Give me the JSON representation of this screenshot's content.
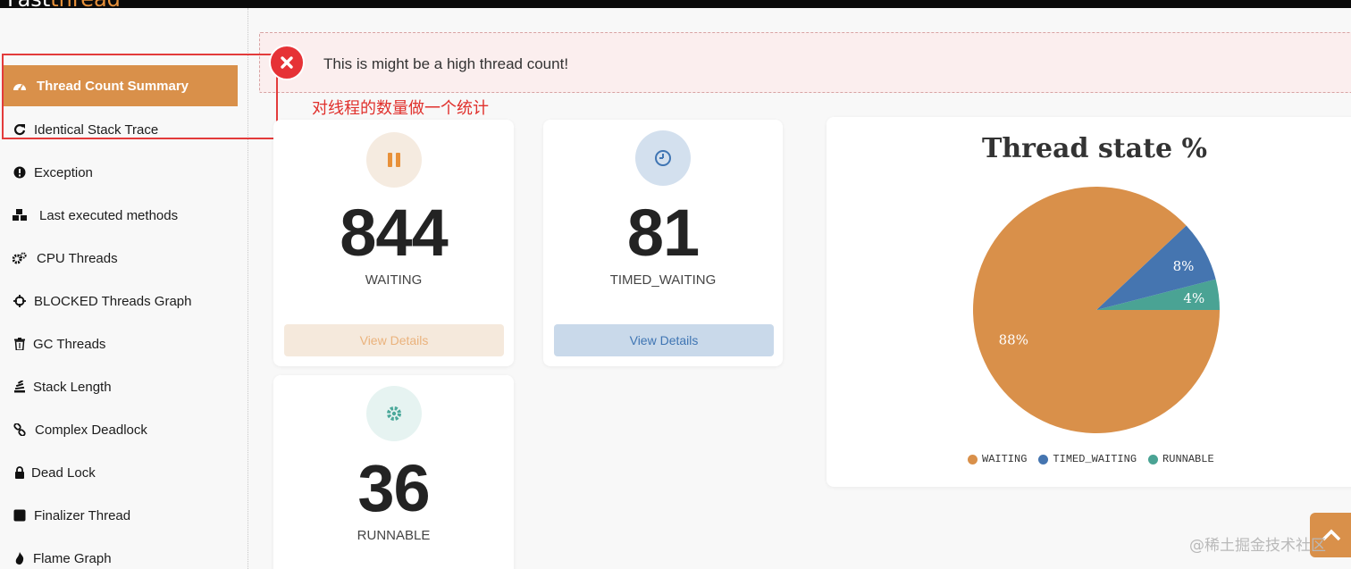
{
  "app": {
    "logo_part1": "Fast",
    "logo_part2": "thread"
  },
  "sidebar": {
    "items": [
      {
        "label": "Thread Count Summary",
        "icon": "dashboard-icon"
      },
      {
        "label": "Identical Stack Trace",
        "icon": "refresh-icon"
      },
      {
        "label": "Exception",
        "icon": "exclamation-circle-icon"
      },
      {
        "label": "Last executed methods",
        "icon": "cubes-icon"
      },
      {
        "label": "CPU Threads",
        "icon": "cogs-icon"
      },
      {
        "label": "BLOCKED Threads Graph",
        "icon": "crosshairs-icon"
      },
      {
        "label": "GC Threads",
        "icon": "trash-icon"
      },
      {
        "label": "Stack Length",
        "icon": "stack-icon"
      },
      {
        "label": "Complex Deadlock",
        "icon": "link-icon"
      },
      {
        "label": "Dead Lock",
        "icon": "lock-icon"
      },
      {
        "label": "Finalizer Thread",
        "icon": "square-icon"
      },
      {
        "label": "Flame Graph",
        "icon": "fire-icon"
      }
    ]
  },
  "alert": {
    "text": "This is might be a high thread count!",
    "icon": "close-circle-icon"
  },
  "annotation": {
    "text": "对线程的数量做一个统计"
  },
  "cards": {
    "waiting": {
      "count": "844",
      "label": "WAITING",
      "button": "View Details",
      "icon": "pause-icon",
      "color": "#e8913a"
    },
    "timed_waiting": {
      "count": "81",
      "label": "TIMED_WAITING",
      "button": "View Details",
      "icon": "clock-icon",
      "color": "#3f75b3"
    },
    "runnable": {
      "count": "36",
      "label": "RUNNABLE",
      "icon": "gear-icon",
      "color": "#4aa89a"
    }
  },
  "chart_data": {
    "type": "pie",
    "title": "Thread state %",
    "slices": [
      {
        "name": "WAITING",
        "value": 88,
        "label": "88%",
        "color": "#d9904a"
      },
      {
        "name": "TIMED_WAITING",
        "value": 8,
        "label": "8%",
        "color": "#4575b0"
      },
      {
        "name": "RUNNABLE",
        "value": 4,
        "label": "4%",
        "color": "#4aa394"
      }
    ],
    "legend_position": "bottom"
  },
  "watermark": "@稀土掘金技术社区"
}
